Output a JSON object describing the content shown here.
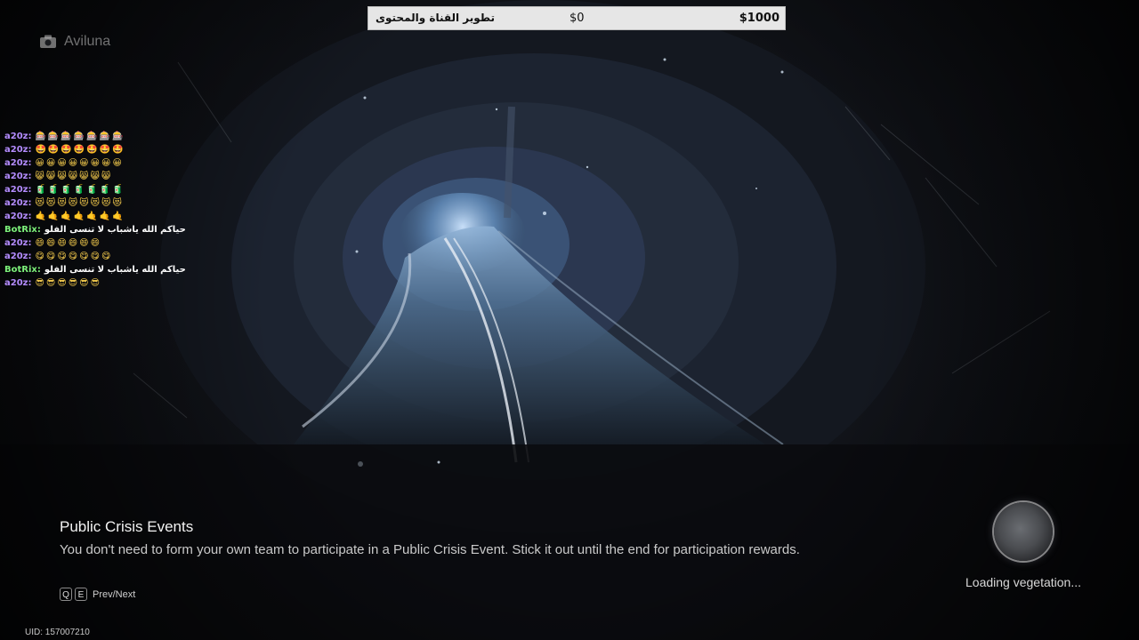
{
  "donation": {
    "title": "تطوير القناة والمحتوى",
    "current": "$0",
    "goal": "$1000",
    "progress": 0
  },
  "watermark": {
    "text": "Aviluna",
    "icon": "camera-icon"
  },
  "chat": {
    "messages": [
      {
        "user": "a20z:",
        "text": "",
        "emotes": "🎰🎰🎰🎰🎰🎰🎰"
      },
      {
        "user": "a20z:",
        "text": "",
        "emotes": "🤩🤩🤩🤩🤩🤩🤩"
      },
      {
        "user": "a20z:",
        "text": "",
        "emotes": "😀😀😀😀😀😀😀😀"
      },
      {
        "user": "a20z:",
        "text": "",
        "emotes": "😸😸😸😸😸😸😸"
      },
      {
        "user": "a20z:",
        "text": "",
        "emotes": "🧃🧃🧃🧃🧃🧃🧃"
      },
      {
        "user": "a20z:",
        "text": "",
        "emotes": "😻😻😻😻😻😻😻😻"
      },
      {
        "user": "a20z:",
        "text": "",
        "emotes": "🤙🤙🤙🤙🤙🤙🤙"
      },
      {
        "user": "BotRix:",
        "text": "حياكم الله ياشباب لا تنسى الفلو",
        "emotes": ""
      },
      {
        "user": "a20z:",
        "text": "",
        "emotes": "😄😄😄😄😄😄"
      },
      {
        "user": "a20z:",
        "text": "",
        "emotes": "😋😋😋😋😋😋😋"
      },
      {
        "user": "BotRix:",
        "text": "حياكم الله ياشباب لا تنسى الفلو",
        "emotes": ""
      },
      {
        "user": "a20z:",
        "text": "",
        "emotes": "😎😎😎😎😎😎"
      }
    ],
    "colors": {
      "a20z": "#b48cff",
      "BotRix": "#7cf07a"
    }
  },
  "tip": {
    "title": "Public Crisis Events",
    "body": "You don't need to form your own team to participate in a Public Crisis Event. Stick it out until the end for participation rewards."
  },
  "nav": {
    "prev_key": "Q",
    "next_key": "E",
    "label": "Prev/Next"
  },
  "uid": "UID: 157007210",
  "loading": {
    "text": "Loading vegetation..."
  }
}
